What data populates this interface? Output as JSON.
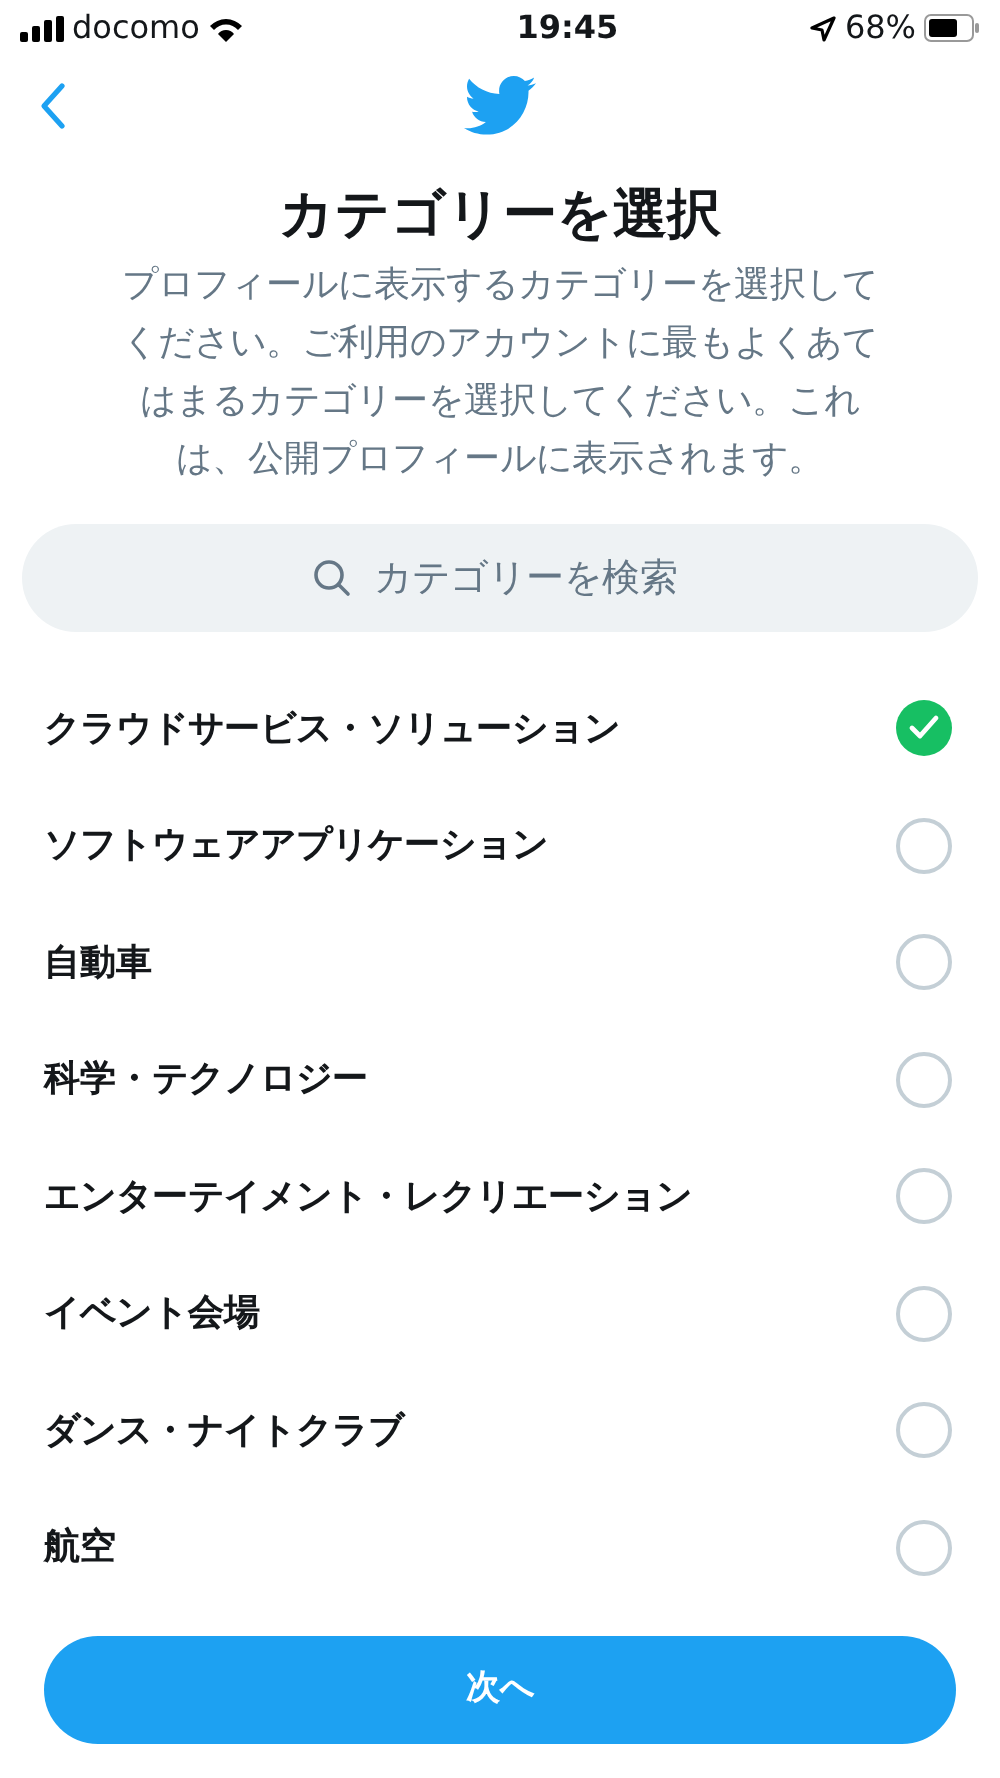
{
  "status_bar": {
    "carrier": "docomo",
    "time": "19:45",
    "battery": "68%"
  },
  "header": {
    "title": "カテゴリーを選択",
    "description": "プロフィールに表示するカテゴリーを選択してください。ご利用のアカウントに最もよくあてはまるカテゴリーを選択してください。これは、公開プロフィールに表示されます。"
  },
  "search": {
    "placeholder": "カテゴリーを検索"
  },
  "categories": [
    {
      "label": "クラウドサービス・ソリューション",
      "selected": true
    },
    {
      "label": "ソフトウェアアプリケーション",
      "selected": false
    },
    {
      "label": "自動車",
      "selected": false
    },
    {
      "label": "科学・テクノロジー",
      "selected": false
    },
    {
      "label": "エンターテイメント・レクリエーション",
      "selected": false
    },
    {
      "label": "イベント会場",
      "selected": false
    },
    {
      "label": "ダンス・ナイトクラブ",
      "selected": false
    },
    {
      "label": "航空",
      "selected": false
    }
  ],
  "next_button": {
    "label": "次へ"
  }
}
